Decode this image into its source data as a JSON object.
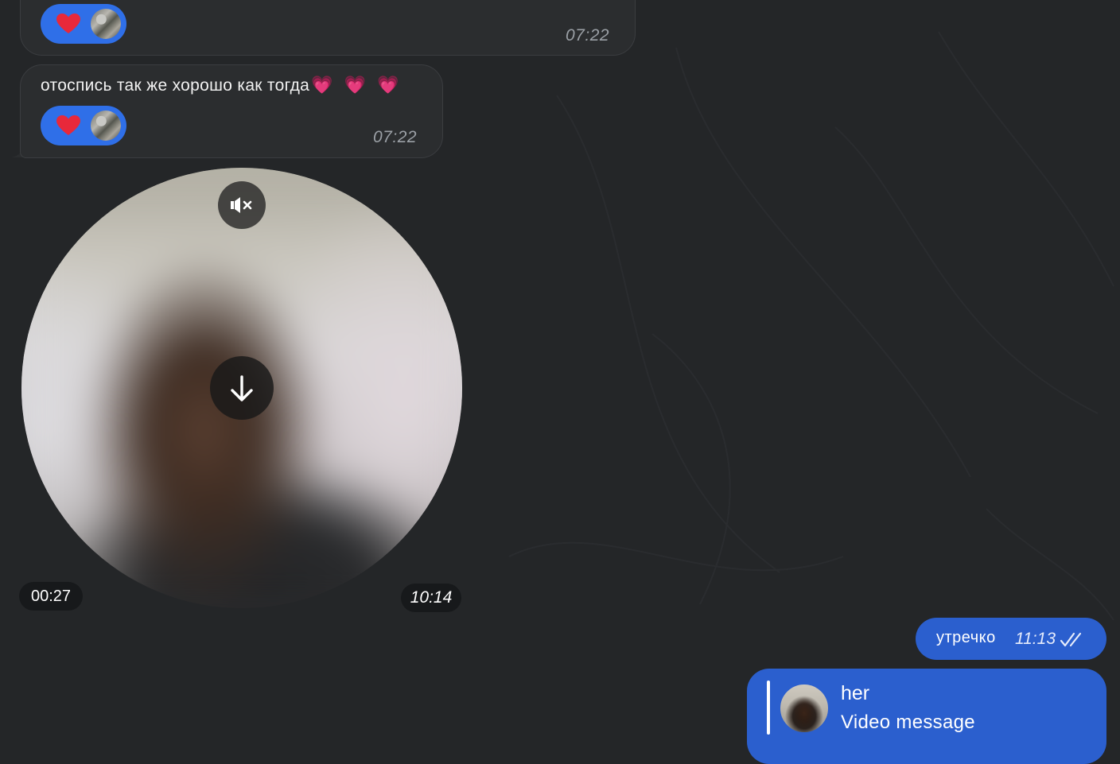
{
  "colors": {
    "background": "#242628",
    "incoming_bubble": "#2b2d2f",
    "outgoing_bubble": "#2b5fce",
    "reaction_pill": "#2f6fe8",
    "heart": "#e8283a"
  },
  "messages_in": [
    {
      "text": "",
      "time": "07:22",
      "reaction": {
        "icon": "heart-icon"
      }
    },
    {
      "text": "отоспись так же хорошо как тогда",
      "emoji": "💗 💗 💗",
      "time": "07:22",
      "reaction": {
        "icon": "heart-icon"
      }
    }
  ],
  "video_message": {
    "duration": "00:27",
    "time": "10:14",
    "mute_icon": "speaker-muted-icon",
    "download_icon": "download-arrow-icon"
  },
  "messages_out": [
    {
      "text": "утречко",
      "time": "11:13",
      "status_icon": "double-check-icon"
    }
  ],
  "reply": {
    "name": "her",
    "subtitle": "Video message"
  }
}
